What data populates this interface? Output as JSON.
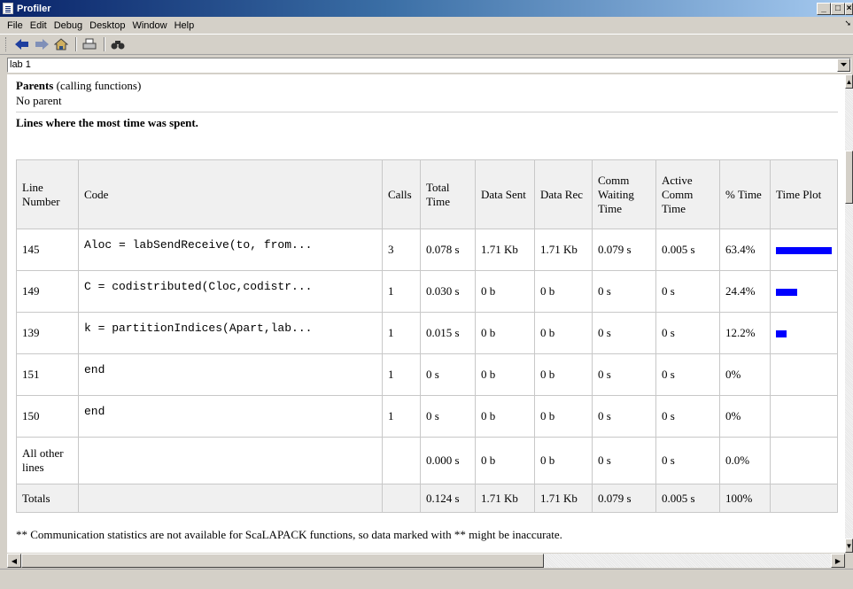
{
  "window": {
    "title": "Profiler"
  },
  "menu": [
    "File",
    "Edit",
    "Debug",
    "Desktop",
    "Window",
    "Help"
  ],
  "toolbar": {
    "icons": [
      "back-arrow-icon",
      "forward-arrow-icon",
      "home-icon",
      "print-icon",
      "find-icon"
    ]
  },
  "address": {
    "value": "lab 1"
  },
  "parents": {
    "heading_bold": "Parents",
    "heading_rest": " (calling functions)",
    "value": "No parent"
  },
  "lines_heading": "Lines where the most time was spent.",
  "table": {
    "headers": [
      "Line Number",
      "Code",
      "Calls",
      "Total Time",
      "Data Sent",
      "Data Rec",
      "Comm Waiting Time",
      "Active Comm Time",
      "% Time",
      "Time Plot"
    ],
    "rows": [
      {
        "line": "145",
        "code": "Aloc = labSendReceive(to, from...",
        "calls": "3",
        "total": "0.078 s",
        "sent": "1.71 Kb",
        "rec": "1.71 Kb",
        "wait": "0.079 s",
        "active": "0.005 s",
        "pct": "63.4%",
        "plot": 0.634
      },
      {
        "line": "149",
        "code": "C = codistributed(Cloc,codistr...",
        "calls": "1",
        "total": "0.030 s",
        "sent": "0 b",
        "rec": "0 b",
        "wait": "0 s",
        "active": "0 s",
        "pct": "24.4%",
        "plot": 0.244
      },
      {
        "line": "139",
        "code": "k = partitionIndices(Apart,lab...",
        "calls": "1",
        "total": "0.015 s",
        "sent": "0 b",
        "rec": "0 b",
        "wait": "0 s",
        "active": "0 s",
        "pct": "12.2%",
        "plot": 0.122
      },
      {
        "line": "151",
        "code": "end",
        "calls": "1",
        "total": "0 s",
        "sent": "0 b",
        "rec": "0 b",
        "wait": "0 s",
        "active": "0 s",
        "pct": "0%",
        "plot": 0
      },
      {
        "line": "150",
        "code": "end",
        "calls": "1",
        "total": "0 s",
        "sent": "0 b",
        "rec": "0 b",
        "wait": "0 s",
        "active": "0 s",
        "pct": "0%",
        "plot": 0
      }
    ],
    "other": {
      "line": "All other lines",
      "code": "",
      "calls": "",
      "total": "0.000 s",
      "sent": "0 b",
      "rec": "0 b",
      "wait": "0 s",
      "active": "0 s",
      "pct": "0.0%"
    },
    "totals": {
      "line": "Totals",
      "code": "",
      "calls": "",
      "total": "0.124 s",
      "sent": "1.71 Kb",
      "rec": "1.71 Kb",
      "wait": "0.079 s",
      "active": "0.005 s",
      "pct": "100%"
    }
  },
  "footnote": "** Communication statistics are not available for ScaLAPACK functions, so data marked with ** might be inaccurate.",
  "colors": {
    "bar": "#0000ff",
    "titlebar": "#0a246a"
  }
}
